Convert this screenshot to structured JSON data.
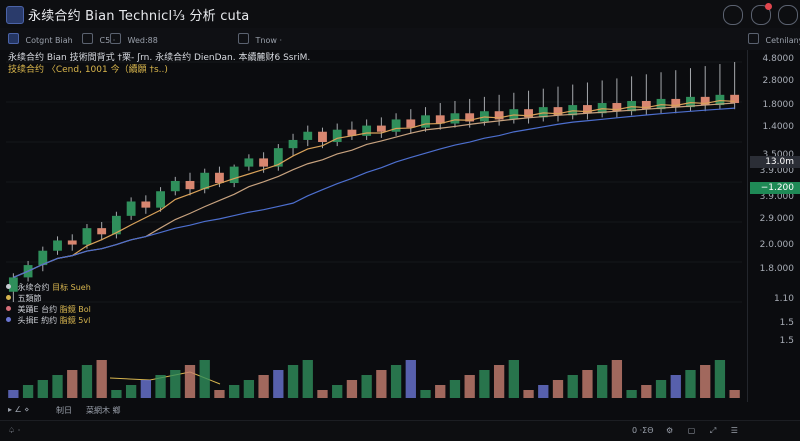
{
  "app": {
    "title": "永续合约 Bian Technicl⅓ 分析 cuta"
  },
  "toolbar": {
    "symbol": "Cotgnt Biah",
    "interval": "C5 ·",
    "view": "Wed:88",
    "tool_search": "Tnow ·",
    "settings": "Cetnilany"
  },
  "chart_header": {
    "line1": "永续合约 Bian 技術間背式  †栗- ʃrn. 永续合约 DienDan. 本續麓财6 SsriM.",
    "line2": "技续合约 〈Cend, 1001 今（續願 †s..)"
  },
  "legend": {
    "row1_a": "永续合约",
    "row1_b": "目标 Sueh",
    "row2": "五類節",
    "row3_a": "美踊E 台约",
    "row3_b": "脂鏡 Bol",
    "row4_a": "头揖E 約约",
    "row4_b": "脂鏡 5vl"
  },
  "yaxis": {
    "ticks": [
      "4.8000",
      "2.8000",
      "1.8000",
      "1.4000",
      "3.5000",
      "3.9.000",
      "3.9.000",
      "2.9.000",
      "2.0.000",
      "1.8.000",
      "1.10",
      "1.5",
      "1.5"
    ]
  },
  "price_tags": {
    "current": "13.0m",
    "secondary": "−1.200"
  },
  "bottombar": {
    "left": "▸ ∠ ⋄",
    "label1": "制日",
    "label2": "菜網木 鄉"
  },
  "footer": {
    "left": "♤ ·",
    "right_time": "0 ·ΣΘ"
  },
  "colors": {
    "up": "#2f8f5b",
    "down": "#d88670",
    "wick": "#a6a9ad",
    "ma_fast": "#d9a25a",
    "ma_slow": "#c7a27f",
    "ma_long": "#4d6fcf",
    "signal": "#d7b54f",
    "vol_up": "#2f8f5b",
    "vol_down": "#c77f70",
    "vol_blue": "#6a76d3"
  },
  "chart_data": {
    "type": "candlestick",
    "candles": [
      [
        8,
        15,
        3,
        17
      ],
      [
        15,
        21,
        13,
        23
      ],
      [
        21,
        28,
        18,
        30
      ],
      [
        28,
        33,
        26,
        35
      ],
      [
        33,
        31,
        28,
        36
      ],
      [
        31,
        39,
        29,
        41
      ],
      [
        39,
        36,
        33,
        42
      ],
      [
        36,
        45,
        34,
        47
      ],
      [
        45,
        52,
        43,
        54
      ],
      [
        52,
        49,
        46,
        55
      ],
      [
        49,
        57,
        47,
        59
      ],
      [
        57,
        62,
        55,
        64
      ],
      [
        62,
        58,
        55,
        66
      ],
      [
        58,
        66,
        56,
        68
      ],
      [
        66,
        61,
        59,
        69
      ],
      [
        61,
        69,
        59,
        70
      ],
      [
        69,
        73,
        67,
        75
      ],
      [
        73,
        69,
        66,
        76
      ],
      [
        69,
        78,
        67,
        80
      ],
      [
        78,
        82,
        74,
        85
      ],
      [
        82,
        86,
        79,
        89
      ],
      [
        86,
        81,
        78,
        88
      ],
      [
        81,
        87,
        79,
        90
      ],
      [
        87,
        84,
        82,
        91
      ],
      [
        84,
        89,
        82,
        92
      ],
      [
        89,
        86,
        83,
        93
      ],
      [
        86,
        92,
        84,
        95
      ],
      [
        92,
        88,
        85,
        97
      ],
      [
        88,
        94,
        86,
        98
      ],
      [
        94,
        90,
        87,
        100
      ],
      [
        90,
        95,
        88,
        101
      ],
      [
        95,
        91,
        88,
        102
      ],
      [
        91,
        96,
        89,
        103
      ],
      [
        96,
        92,
        89,
        104
      ],
      [
        92,
        97,
        90,
        105
      ],
      [
        97,
        93,
        90,
        106
      ],
      [
        93,
        98,
        91,
        107
      ],
      [
        98,
        94,
        91,
        108
      ],
      [
        94,
        99,
        92,
        109
      ],
      [
        99,
        95,
        92,
        110
      ],
      [
        95,
        100,
        93,
        111
      ],
      [
        100,
        96,
        93,
        112
      ],
      [
        96,
        101,
        94,
        113
      ],
      [
        101,
        97,
        94,
        114
      ],
      [
        97,
        102,
        95,
        115
      ],
      [
        102,
        98,
        95,
        116
      ],
      [
        98,
        103,
        96,
        117
      ],
      [
        103,
        99,
        96,
        118
      ],
      [
        99,
        104,
        97,
        119
      ],
      [
        104,
        100,
        97,
        120
      ]
    ]
  }
}
